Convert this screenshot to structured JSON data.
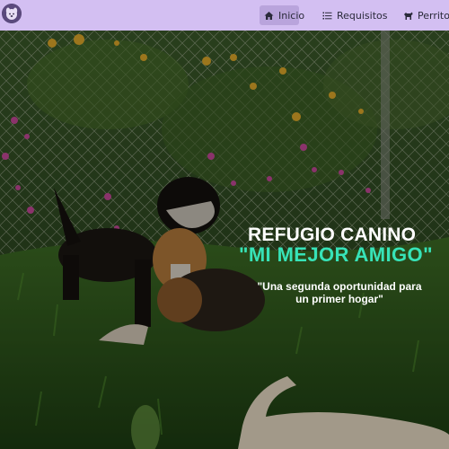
{
  "navbar": {
    "logo_icon": "dog-logo-icon",
    "items": [
      {
        "label": "Inicio",
        "icon": "home-icon",
        "active": true
      },
      {
        "label": "Requisitos",
        "icon": "list-icon",
        "active": false
      },
      {
        "label": "Perritos",
        "icon": "dog-icon",
        "active": false
      }
    ]
  },
  "hero": {
    "title_line1": "REFUGIO CANINO",
    "title_line2": "\"MI MEJOR AMIGO\"",
    "tagline": "\"Una segunda oportunidad para un primer hogar\""
  },
  "colors": {
    "navbar_bg": "#d3bff2",
    "active_bg": "#b9a4dc",
    "accent_teal": "#37e3b8",
    "title_white": "#ffffff"
  }
}
